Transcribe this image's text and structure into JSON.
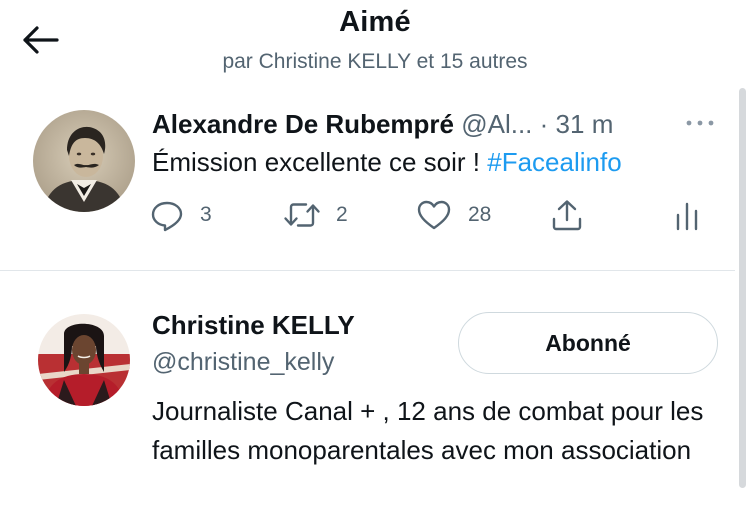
{
  "header": {
    "title": "Aimé",
    "subtitle": "par Christine KELLY et 15 autres"
  },
  "icons": {
    "back": "arrow-left-icon",
    "more": "more-horizontal-icon",
    "reply": "reply-bubble-icon",
    "retweet": "retweet-icon",
    "like": "heart-icon",
    "share": "share-upload-icon",
    "analytics": "analytics-bars-icon"
  },
  "colors": {
    "accent": "#1d9bf0",
    "secondary_text": "#536471",
    "primary_text": "#0f1419",
    "divider": "#e1e6ea"
  },
  "tweet": {
    "author_name": "Alexandre De Rubempré",
    "author_handle": "@Al...",
    "separator": "·",
    "time": "31 m",
    "text": "Émission excellente ce soir ! ",
    "hashtag": "#Facealinfo",
    "reply_count": "3",
    "retweet_count": "2",
    "like_count": "28"
  },
  "user": {
    "name": "Christine KELLY",
    "handle": "@christine_kelly",
    "follow_label": "Abonné",
    "bio": "Journaliste Canal + , 12 ans de combat pour les familles monoparentales avec mon association"
  }
}
